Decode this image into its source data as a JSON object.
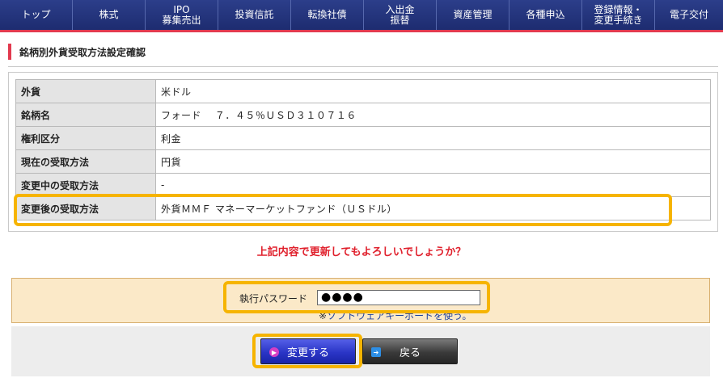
{
  "nav": [
    {
      "line1": "トップ",
      "line2": ""
    },
    {
      "line1": "株式",
      "line2": ""
    },
    {
      "line1": "IPO",
      "line2": "募集売出"
    },
    {
      "line1": "投資信託",
      "line2": ""
    },
    {
      "line1": "転換社債",
      "line2": ""
    },
    {
      "line1": "入出金",
      "line2": "振替"
    },
    {
      "line1": "資産管理",
      "line2": ""
    },
    {
      "line1": "各種申込",
      "line2": ""
    },
    {
      "line1": "登録情報・",
      "line2": "変更手続き"
    },
    {
      "line1": "電子交付",
      "line2": ""
    }
  ],
  "page_title": "銘柄別外貨受取方法設定確認",
  "info_rows": [
    {
      "label": "外貨",
      "value": "米ドル"
    },
    {
      "label": "銘柄名",
      "value": "フォード　 ７．４５％ＵＳＤ３１０７１６"
    },
    {
      "label": "権利区分",
      "value": "利金"
    },
    {
      "label": "現在の受取方法",
      "value": "円貨"
    },
    {
      "label": "変更中の受取方法",
      "value": "-"
    },
    {
      "label": "変更後の受取方法",
      "value": "外貨ＭＭＦ マネーマーケットファンド（ＵＳドル）"
    }
  ],
  "confirm_message": "上記内容で更新してもよろしいでしょうか？",
  "password": {
    "label": "執行パスワード",
    "masked_value": "●●●●",
    "soft_keyboard_link": "ソフトウェアキーボードを使う。",
    "soft_keyboard_prefix": "※"
  },
  "buttons": {
    "submit_label": "変更する",
    "back_label": "戻る"
  },
  "colors": {
    "nav_bg": "#1d2c70",
    "accent_red": "#e23a4f",
    "highlight_orange": "#f6b400",
    "submit_blue": "#2a35c6"
  }
}
